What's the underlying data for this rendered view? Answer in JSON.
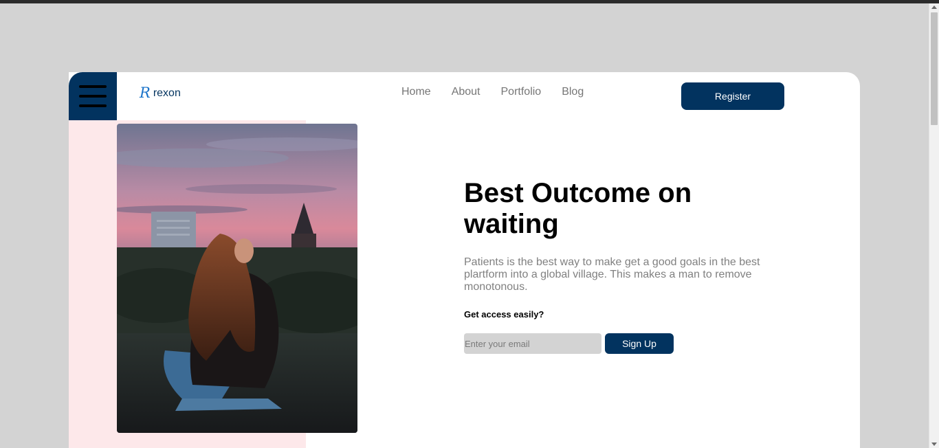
{
  "brand": {
    "mark": "R",
    "name": "rexon"
  },
  "nav": {
    "items": [
      "Home",
      "About",
      "Portfolio",
      "Blog"
    ]
  },
  "header": {
    "register_label": "Register"
  },
  "hero": {
    "title": "Best Outcome on waiting",
    "description": "Patients is the best way to make get a good goals in the best plartform into a global village. This makes a man to remove monotonous.",
    "access_label": "Get access easily?",
    "email_placeholder": "Enter your email",
    "signup_label": "Sign Up"
  },
  "colors": {
    "primary": "#02335f",
    "accent_panel": "#fde8ea",
    "page_bg": "#d3d3d3"
  },
  "icons": {
    "menu": "hamburger-menu-icon"
  }
}
